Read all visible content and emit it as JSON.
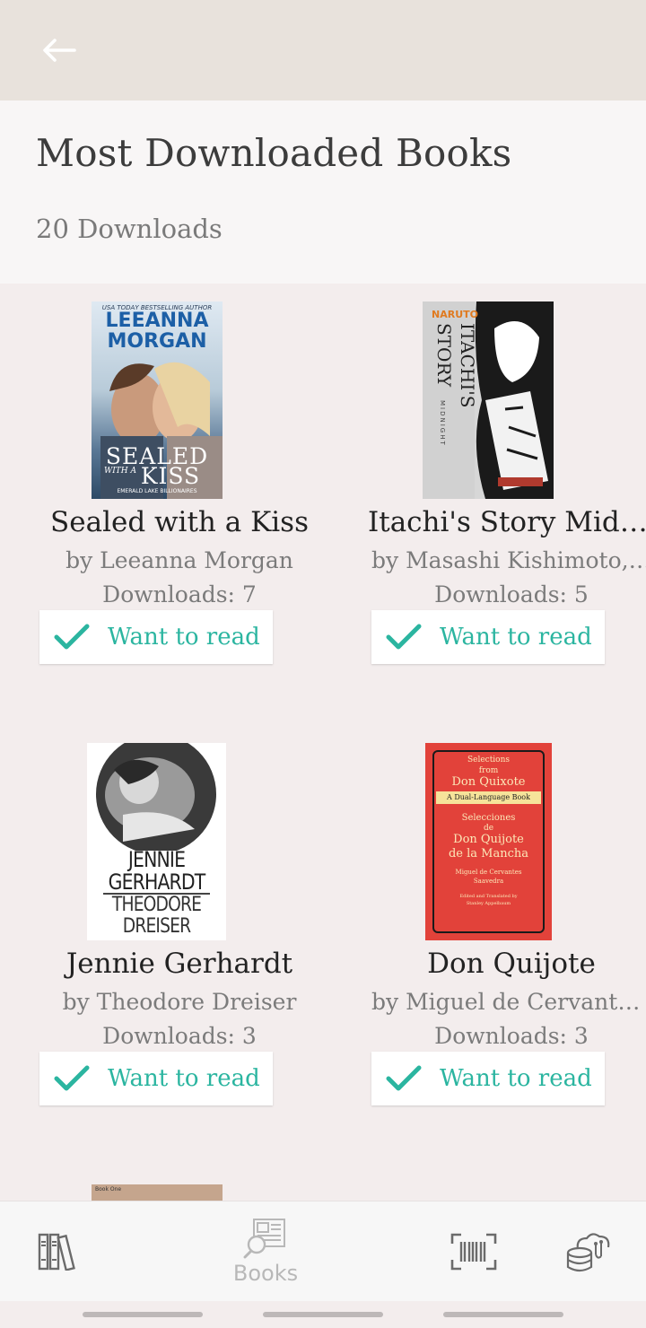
{
  "header": {
    "title": "Most Downloaded Books",
    "subtitle": "20 Downloads"
  },
  "books": [
    {
      "title": "Sealed with a Kiss",
      "author": "by Leeanna Morgan",
      "downloads": "Downloads: 7",
      "action": "Want to read",
      "cover": {
        "top_text": "USA TODAY BESTSELLING AUTHOR",
        "author_line1": "LEEANNA",
        "author_line2": "MORGAN",
        "title_line1": "SEALED",
        "title_small": "WITH A",
        "title_line2": "KISS",
        "series": "EMERALD LAKE BILLIONAIRES"
      }
    },
    {
      "title": "Itachi's Story Midnight",
      "author": "by Masashi Kishimoto, Takashi Yano",
      "downloads": "Downloads: 5",
      "action": "Want to read",
      "cover": {
        "brand": "NARUTO",
        "title": "ITACHI'S",
        "title2": "STORY",
        "subtitle": "MIDNIGHT"
      }
    },
    {
      "title": "Jennie Gerhardt",
      "author": "by Theodore Dreiser",
      "downloads": "Downloads: 3",
      "action": "Want to read",
      "cover": {
        "line1": "JENNIE",
        "line2": "GERHARDT",
        "line3": "THEODORE",
        "line4": "DREISER"
      }
    },
    {
      "title": "Don Quijote",
      "author": "by Miguel de Cervantes Saavedra",
      "downloads": "Downloads: 3",
      "action": "Want to read",
      "cover": {
        "l1": "Selections",
        "l2": "from",
        "l3": "Don Quixote",
        "l4": "A Dual-Language Book",
        "l5": "Selecciones",
        "l6": "de",
        "l7": "Don Quijote",
        "l8": "de la Mancha",
        "l9": "Miguel de Cervantes",
        "l10": "Saavedra",
        "l11": "Edited and Translated by",
        "l12": "Stanley Appelbaum"
      }
    }
  ],
  "partial_cover": {
    "text": "Book One"
  },
  "bottom_nav": {
    "items": [
      {
        "icon": "bookshelf-icon",
        "label": ""
      },
      {
        "icon": "book-search-icon",
        "label": "Books"
      },
      {
        "icon": "barcode-scan-icon",
        "label": ""
      },
      {
        "icon": "cloud-database-icon",
        "label": ""
      }
    ]
  },
  "colors": {
    "accent": "#2bb5a0",
    "background": "#f3eded",
    "topbar": "#e8e2dc"
  }
}
